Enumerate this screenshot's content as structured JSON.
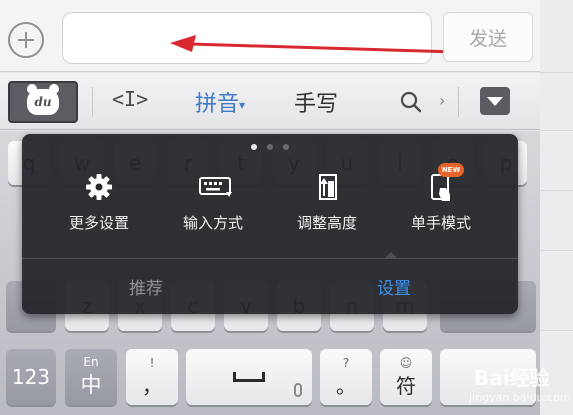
{
  "message_bar": {
    "send_label": "发送",
    "input_value": "",
    "annotation_arrow_color": "#d9282f"
  },
  "toolbar": {
    "logo_text": "du",
    "cursor_glyph": "<I>",
    "pinyin_label": "拼音",
    "pinyin_caret": "▾",
    "handwriting_label": "手写",
    "chevron_glyph": "›",
    "icons": [
      "du-bear-logo-icon",
      "cursor-move-icon",
      "search-icon",
      "chevron-right-icon",
      "collapse-keyboard-icon"
    ]
  },
  "keyboard": {
    "row1_letters": [
      "q",
      "w",
      "e",
      "r",
      "t",
      "y",
      "u",
      "i",
      "o",
      "p"
    ],
    "row3_letters": [
      "z",
      "x",
      "c",
      "v",
      "b",
      "n",
      "m"
    ],
    "key_123": "123",
    "key_lang_small": "En",
    "key_lang_big": "中",
    "key_comma_small": "!",
    "key_comma_big": "，",
    "key_dot_small": "?",
    "key_dot_big": "。",
    "key_symbol_small": "☺",
    "key_symbol_big": "符"
  },
  "popup": {
    "page_count": 3,
    "active_page": 0,
    "items": [
      {
        "label": "更多设置",
        "icon": "gear-icon"
      },
      {
        "label": "输入方式",
        "icon": "keyboard-icon"
      },
      {
        "label": "调整高度",
        "icon": "height-adjust-icon"
      },
      {
        "label": "单手模式",
        "icon": "one-hand-icon",
        "badge": "NEW"
      }
    ],
    "tabs": [
      {
        "label": "推荐",
        "active": false
      },
      {
        "label": "设置",
        "active": true
      }
    ],
    "active_color": "#3b92f0"
  },
  "watermark": {
    "text": "Bai经验",
    "url": "jingyan.baidu.com"
  }
}
